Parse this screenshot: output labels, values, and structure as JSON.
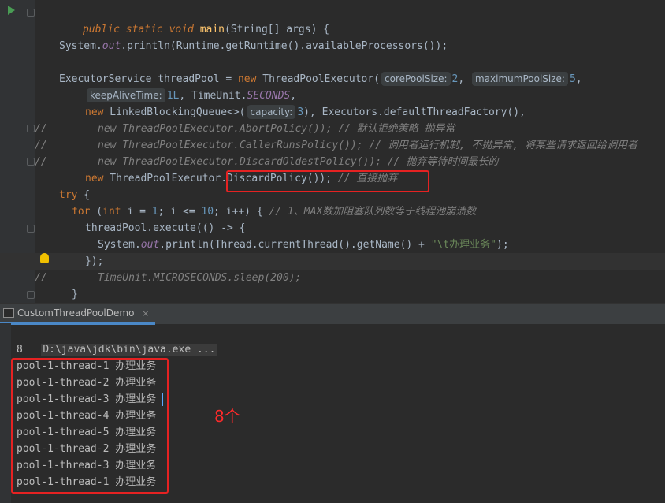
{
  "editor": {
    "main_sig": [
      "public",
      "static",
      "void",
      "main",
      "(String[] args) {"
    ],
    "println_line": {
      "system": "System",
      "out": "out",
      "println": "println",
      "runtime": "Runtime",
      "getRuntime": "getRuntime",
      "avail": "availableProcessors",
      "tail": "());"
    },
    "executor_line": {
      "type": "ExecutorService threadPool = ",
      "new": "new",
      "cls": " ThreadPoolExecutor(",
      "hint1": "corePoolSize:",
      "v1": "2",
      "hint2": "maximumPoolSize:",
      "v2": "5",
      "comma": ","
    },
    "keepalive_line": {
      "hint": "keepAliveTime:",
      "v": "1L",
      "unit_cls": "TimeUnit.",
      "unit_field": "SECONDS",
      "tail": ","
    },
    "queue_line": {
      "new": "new",
      "cls": " LinkedBlockingQueue<>(",
      "hint": "capacity:",
      "v": "3",
      "mid": "), Executors.",
      "factory": "defaultThreadFactory",
      "tail": "(),"
    },
    "comment_lines": [
      "new ThreadPoolExecutor.AbortPolicy()); // 默认拒绝策略 抛异常",
      "new ThreadPoolExecutor.CallerRunsPolicy()); // 调用者运行机制, 不抛异常, 将某些请求返回给调用者",
      "new ThreadPoolExecutor.DiscardOldestPolicy()); // 抛弃等待时间最长的"
    ],
    "comment_prefix": "//",
    "discard_line": {
      "new": "new",
      "cls": " ThreadPoolExecutor.",
      "policy": "DiscardPolicy());",
      "comment": " // 直接抛弃"
    },
    "try_line": {
      "kw": "try",
      "tail": " {"
    },
    "for_line": {
      "kw": "for",
      "open": " (",
      "int": "int",
      "mid": " i = ",
      "v1": "1",
      "mid2": "; i <= ",
      "v2": "10",
      "mid3": "; i++) { ",
      "comment": "// 1、MAX数加阻塞队列数等于线程池崩溃数"
    },
    "execute_line": {
      "obj": "threadPool.",
      "meth": "execute",
      "tail": "(() -> {"
    },
    "println2_line": {
      "system": "System.",
      "out": "out",
      "dot": ".",
      "println": "println",
      "open": "(Thread.",
      "current": "currentThread",
      "mid": "().",
      "getname": "getName",
      "mid2": "() + ",
      "str": "\"\\t办理业务\"",
      "tail": ");"
    },
    "close_lambda": "});",
    "sleep_line": {
      "cls": "TimeUnit.",
      "field": "MICROSECONDS",
      "tail": ".sleep(200);"
    },
    "close_brace": "}"
  },
  "console": {
    "tab_label": "CustomThreadPoolDemo",
    "tab_close": "×",
    "cmd": "D:\\java\\jdk\\bin\\java.exe ...",
    "first_output": "8",
    "lines": [
      "pool-1-thread-1 办理业务",
      "pool-1-thread-2 办理业务",
      "pool-1-thread-3 办理业务",
      "pool-1-thread-4 办理业务",
      "pool-1-thread-5 办理业务",
      "pool-1-thread-2 办理业务",
      "pool-1-thread-3 办理业务",
      "pool-1-thread-1 办理业务"
    ],
    "annotation": "8个"
  },
  "colors": {
    "highlight_box": "#e52222",
    "keyword": "#cc7832",
    "string": "#6a8759",
    "number": "#6897bb"
  }
}
